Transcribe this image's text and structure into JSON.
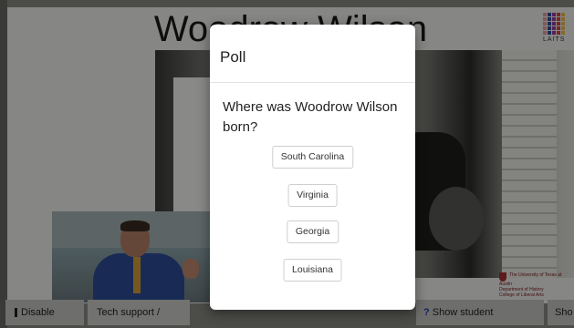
{
  "slide": {
    "title": "Woodrow Wilson",
    "logo_text": "LAITS",
    "seal_lines": [
      "The University of Texas at Austin",
      "Department of History",
      "College of Liberal Arts"
    ]
  },
  "poll": {
    "title": "Poll",
    "question": "Where was Woodrow Wilson born?",
    "options": [
      "South Carolina",
      "Virginia",
      "Georgia",
      "Louisiana"
    ]
  },
  "toolbar": {
    "disable_video": "Disable Video",
    "tech_support": "Tech support / Help",
    "show_questions": "Show student questions",
    "show_more": "Sho"
  },
  "colors": {
    "question_mark": "#2b3fb5",
    "logo_colors": [
      "#e8a0a0",
      "#d44",
      "#7aa7d8",
      "#2b4fa0",
      "#f0c040",
      "#50a050",
      "#9a3ca0",
      "#e07030"
    ]
  },
  "icons": [
    "video-indicator-icon",
    "question-icon",
    "laits-logo-icon",
    "university-seal-icon"
  ]
}
